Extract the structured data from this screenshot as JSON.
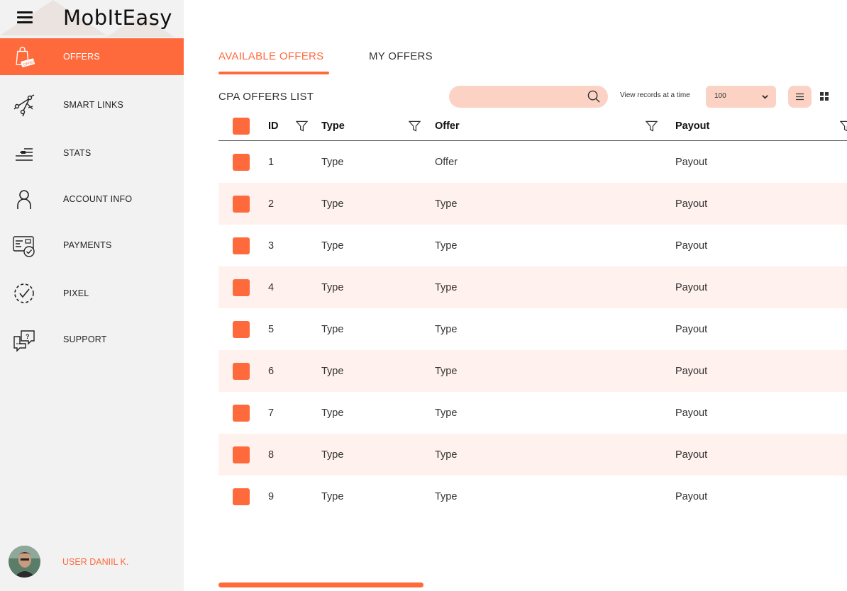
{
  "app": {
    "brand": "MobItEasy"
  },
  "sidebar": {
    "items": [
      {
        "label": "OFFERS",
        "icon": "shopping-bag-offer-icon",
        "active": true
      },
      {
        "label": "SMART LINKS",
        "icon": "smart-links-icon",
        "active": false
      },
      {
        "label": "STATS",
        "icon": "stats-icon",
        "active": false
      },
      {
        "label": "ACCOUNT INFO",
        "icon": "user-icon",
        "active": false
      },
      {
        "label": "PAYMENTS",
        "icon": "payment-card-icon",
        "active": false
      },
      {
        "label": "PIXEL",
        "icon": "pixel-check-icon",
        "active": false
      },
      {
        "label": "SUPPORT",
        "icon": "support-chat-icon",
        "active": false
      }
    ],
    "offer_badge": "OFFER",
    "user": {
      "name": "USER DANIIL K."
    }
  },
  "tabs": {
    "available": "AVAILABLE OFFERS",
    "my": "MY OFFERS"
  },
  "toolbar": {
    "list_title": "CPA OFFERS LIST",
    "search_placeholder": "",
    "records_label": "View  records at a time",
    "records_value": "100"
  },
  "table": {
    "headers": {
      "id": "ID",
      "type": "Type",
      "offer": "Offer",
      "payout": "Payout"
    },
    "rows": [
      {
        "id": "1",
        "type": "Type",
        "offer": "Offer",
        "payout": "Payout"
      },
      {
        "id": "2",
        "type": "Type",
        "offer": "Type",
        "payout": "Payout"
      },
      {
        "id": "3",
        "type": "Type",
        "offer": "Type",
        "payout": "Payout"
      },
      {
        "id": "4",
        "type": "Type",
        "offer": "Type",
        "payout": "Payout"
      },
      {
        "id": "5",
        "type": "Type",
        "offer": "Type",
        "payout": "Payout"
      },
      {
        "id": "6",
        "type": "Type",
        "offer": "Type",
        "payout": "Payout"
      },
      {
        "id": "7",
        "type": "Type",
        "offer": "Type",
        "payout": "Payout"
      },
      {
        "id": "8",
        "type": "Type",
        "offer": "Type",
        "payout": "Payout"
      },
      {
        "id": "9",
        "type": "Type",
        "offer": "Type",
        "payout": "Payout"
      }
    ]
  },
  "colors": {
    "accent": "#ff6a3d",
    "accent_light": "#fbd2c4",
    "row_alt": "#fff1ed",
    "sidebar_bg": "#f2f2f2"
  }
}
